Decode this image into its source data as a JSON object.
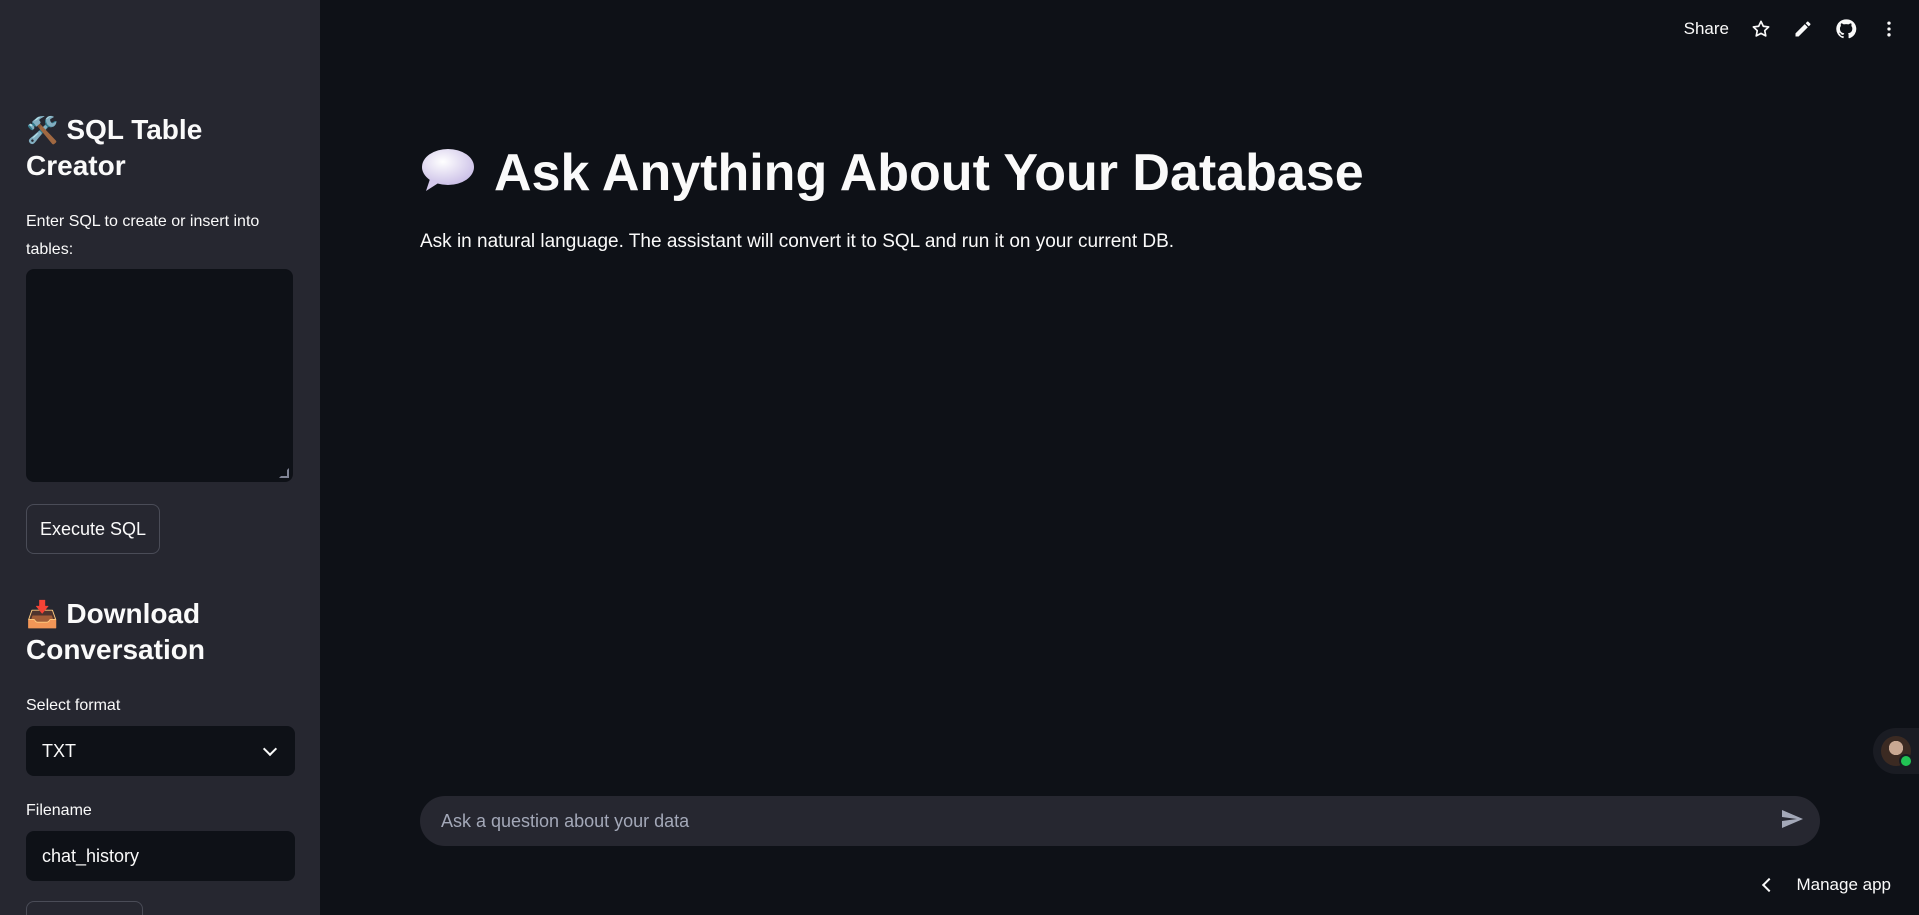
{
  "sidebar": {
    "sql_section": {
      "emoji": "🛠️",
      "heading": "SQL Table Creator",
      "label": "Enter SQL to create or insert into tables:",
      "textarea_value": "",
      "execute_label": "Execute SQL"
    },
    "download_section": {
      "emoji": "📥",
      "heading": "Download Conversation",
      "format_label": "Select format",
      "format_value": "TXT",
      "filename_label": "Filename",
      "filename_value": "chat_history"
    }
  },
  "toolbar": {
    "share_label": "Share",
    "icons": [
      "star-icon",
      "pencil-icon",
      "github-icon",
      "more-vert-icon"
    ]
  },
  "main": {
    "title_emoji": "💬",
    "title": "Ask Anything About Your Database",
    "subtitle": "Ask in natural language. The assistant will convert it to SQL and run it on your current DB."
  },
  "chat": {
    "placeholder": "Ask a question about your data"
  },
  "footer": {
    "manage_label": "Manage app"
  },
  "colors": {
    "background": "#0e1117",
    "sidebar": "#262730",
    "text": "#fafafa",
    "status_online": "#21c354"
  }
}
